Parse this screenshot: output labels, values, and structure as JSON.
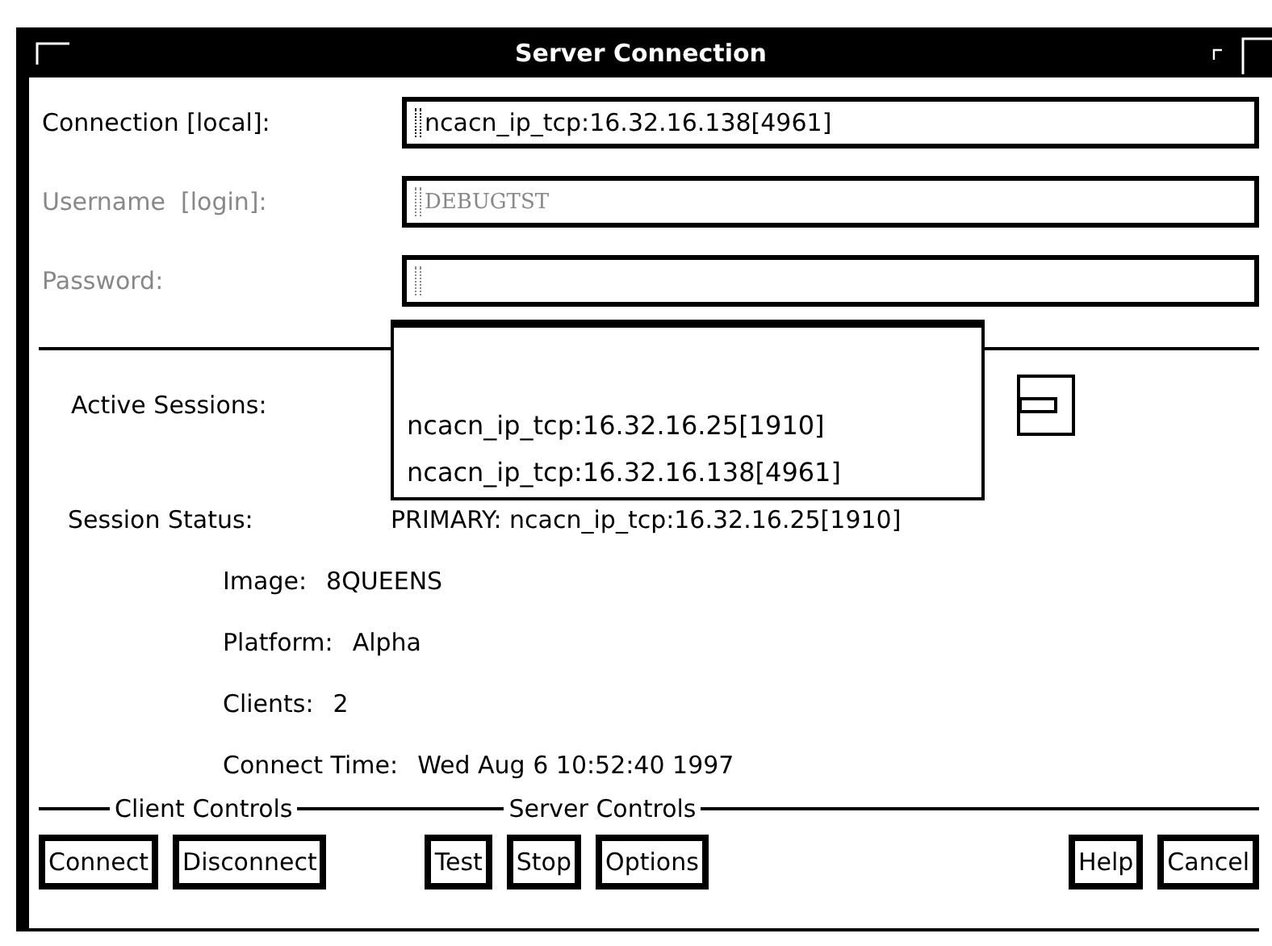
{
  "window": {
    "title": "Server Connection"
  },
  "fields": [
    {
      "label": "Connection [local]:",
      "value": "ncacn_ip_tcp:16.32.16.138[4961]",
      "disabled": false
    },
    {
      "label": "Username  [login]:",
      "value": "DEBUGTST",
      "disabled": true
    },
    {
      "label": "Password:",
      "disabled": true
    }
  ],
  "active_sessions": {
    "label": "Active Sessions:",
    "menu_items": [
      {
        "label": "ncacn_ip_tcp:16.32.16.25[1910]"
      },
      {
        "label": "ncacn_ip_tcp:16.32.16.138[4961]"
      }
    ]
  },
  "session_status": {
    "label": "Session Status:",
    "value": "PRIMARY: ncacn_ip_tcp:16.32.16.25[1910]"
  },
  "details": [
    {
      "label": "Image:",
      "value": "8QUEENS"
    },
    {
      "label": "Platform:",
      "value": "Alpha"
    },
    {
      "label": "Clients:",
      "value": "2"
    },
    {
      "label": "Connect Time:",
      "value": "Wed Aug  6 10:52:40 1997"
    }
  ],
  "groups": [
    {
      "label": "Client Controls",
      "buttons": [
        "Connect",
        "Disconnect"
      ]
    },
    {
      "label": "Server Controls",
      "buttons": [
        "Test",
        "Stop",
        "Options"
      ]
    },
    {
      "buttons": [
        "Help",
        "Cancel"
      ]
    }
  ]
}
